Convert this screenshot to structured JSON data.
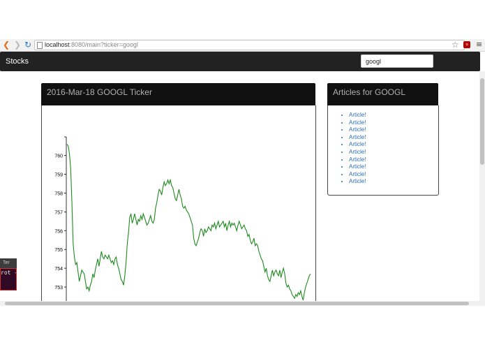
{
  "browser": {
    "url_host": "localhost",
    "url_rest": ":8080/main?ticker=googl"
  },
  "navbar": {
    "brand": "Stocks",
    "search_value": "googl"
  },
  "chart_panel": {
    "title": "2016-Mar-18 GOOGL Ticker"
  },
  "articles_panel": {
    "title": "Articles for GOOGL",
    "items": [
      "Article!",
      "Article!",
      "Article!",
      "Article!",
      "Article!",
      "Article!",
      "Article!",
      "Article!",
      "Article!",
      "Article!"
    ]
  },
  "terminal": {
    "title": "Ter",
    "text": "rot -"
  },
  "colors": {
    "line": "#1f8a1f",
    "navbar": "#222222",
    "panel_header": "#111111",
    "link": "#2a6db0"
  },
  "chart_data": {
    "type": "line",
    "title": "",
    "xlabel": "",
    "ylabel": "",
    "ylim": [
      752.7,
      760.9
    ],
    "ticks": [
      753,
      754,
      755,
      756,
      757,
      758,
      759,
      760
    ],
    "series": [
      {
        "values": [
          760.6,
          760.5,
          760.1,
          759.3,
          757.5,
          755.3,
          754.6,
          754.2,
          754.3,
          753.8,
          753.3,
          753.6,
          753.9,
          753.8,
          753.7,
          753.3,
          752.9,
          753.0,
          752.8,
          753.1,
          753.3,
          753.7,
          753.5,
          753.9,
          754.2,
          754.5,
          754.1,
          754.5,
          754.9,
          754.6,
          754.5,
          754.7,
          754.6,
          754.5,
          754.7,
          754.5,
          754.3,
          754.4,
          754.2,
          754.5,
          754.6,
          754.2,
          754.0,
          753.7,
          753.4,
          753.3,
          753.1,
          753.6,
          754.3,
          755.3,
          755.9,
          756.7,
          756.9,
          756.4,
          756.6,
          756.9,
          756.6,
          756.3,
          756.6,
          756.5,
          756.8,
          756.6,
          756.9,
          756.7,
          756.5,
          756.3,
          756.4,
          756.6,
          756.8,
          756.5,
          756.4,
          756.6,
          757.2,
          757.5,
          757.9,
          758.2,
          758.1,
          757.9,
          758.3,
          758.6,
          758.4,
          758.5,
          758.7,
          758.5,
          758.7,
          758.4,
          758.3,
          758.0,
          757.7,
          757.6,
          757.9,
          758.2,
          757.9,
          757.7,
          757.3,
          757.2,
          757.3,
          757.1,
          757.0,
          756.9,
          756.7,
          756.5,
          756.3,
          755.6,
          755.3,
          755.2,
          755.4,
          755.6,
          755.9,
          756.1,
          756.0,
          755.7,
          756.1,
          755.9,
          756.0,
          756.2,
          756.1,
          756.0,
          756.3,
          756.2,
          756.4,
          756.1,
          756.3,
          756.5,
          756.2,
          756.3,
          756.4,
          756.5,
          756.2,
          756.4,
          756.0,
          756.3,
          756.5,
          756.2,
          756.4,
          756.3,
          756.4,
          756.2,
          756.0,
          756.3,
          756.5,
          756.3,
          756.1,
          756.2,
          756.3,
          756.1,
          756.0,
          755.7,
          755.8,
          755.5,
          755.3,
          755.4,
          755.6,
          755.2,
          755.3,
          755.2,
          754.9,
          754.7,
          754.5,
          754.4,
          754.1,
          753.8,
          754.0,
          753.6,
          753.4,
          753.3,
          753.6,
          753.9,
          753.6,
          753.8,
          753.9,
          753.7,
          753.6,
          753.9,
          753.5,
          753.8,
          754.0,
          753.7,
          753.2,
          753.0,
          753.1,
          752.9,
          752.8,
          752.6,
          752.5,
          752.4,
          752.6,
          752.5,
          752.7,
          752.6,
          752.8,
          752.5,
          752.3,
          752.7,
          753.0,
          753.2,
          753.4,
          753.6,
          753.7
        ]
      }
    ]
  }
}
